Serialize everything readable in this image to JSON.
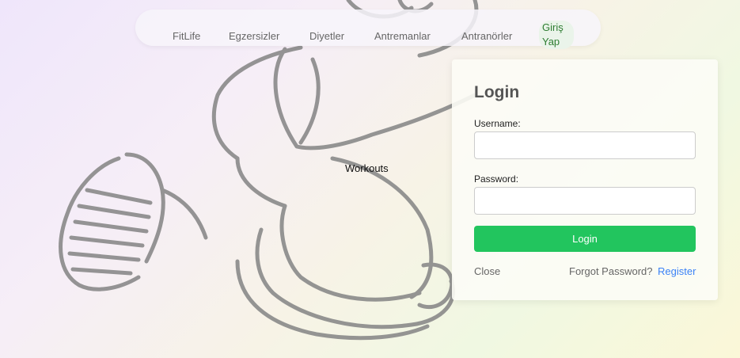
{
  "nav": {
    "items": [
      {
        "label": "FitLife"
      },
      {
        "label": "Egzersizler"
      },
      {
        "label": "Diyetler"
      },
      {
        "label": "Antremanlar"
      },
      {
        "label": "Antranörler"
      }
    ],
    "login_label_line1": "Giriş",
    "login_label_line2": "Yap"
  },
  "hero": {
    "workouts_label": "Workouts"
  },
  "login_form": {
    "title": "Login",
    "username_label": "Username:",
    "username_value": "",
    "password_label": "Password:",
    "password_value": "",
    "submit_label": "Login",
    "close_label": "Close",
    "forgot_label": "Forgot Password?",
    "register_label": "Register"
  },
  "colors": {
    "accent_green": "#22c55e",
    "link_blue": "#3b82f6",
    "nav_active_green": "#2e7d32"
  }
}
